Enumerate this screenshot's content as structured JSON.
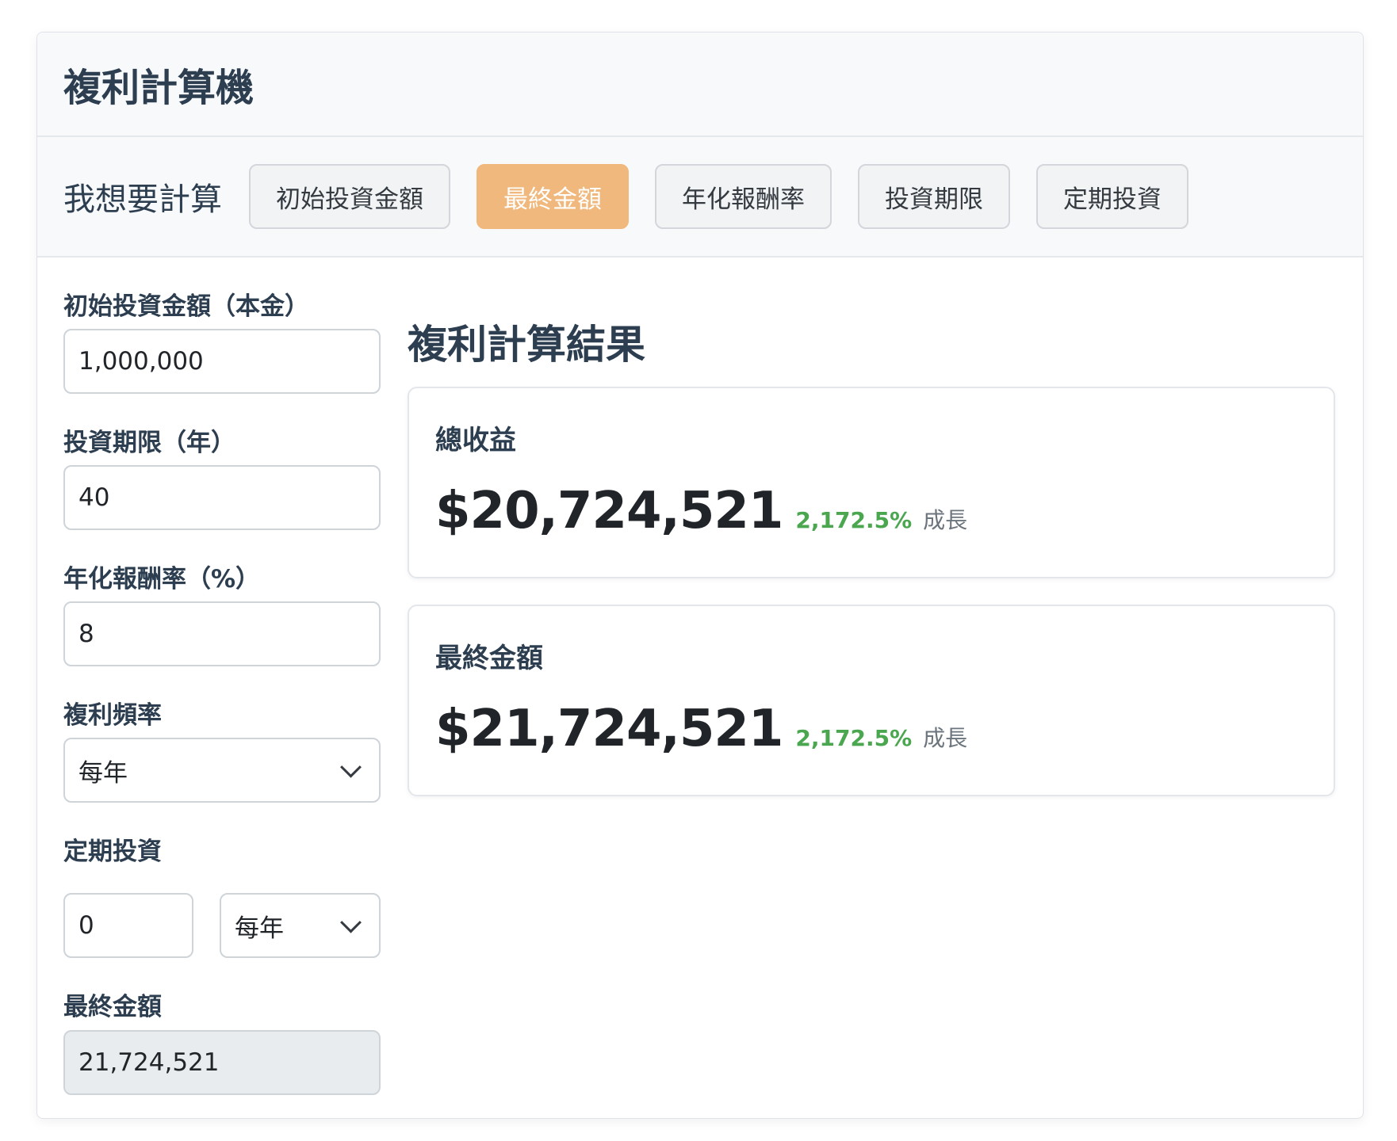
{
  "header": {
    "title": "複利計算機"
  },
  "calc_mode": {
    "label": "我想要計算",
    "options": [
      "初始投資金額",
      "最終金額",
      "年化報酬率",
      "投資期限",
      "定期投資"
    ],
    "active": "最終金額"
  },
  "form": {
    "principal": {
      "label": "初始投資金額（本金）",
      "value": "1,000,000"
    },
    "years": {
      "label": "投資期限（年）",
      "value": "40"
    },
    "rate": {
      "label": "年化報酬率（%）",
      "value": "8"
    },
    "frequency": {
      "label": "複利頻率",
      "value": "每年"
    },
    "periodic": {
      "label": "定期投資",
      "amount": "0",
      "frequency": "每年"
    },
    "final_amount": {
      "label": "最終金額",
      "value": "21,724,521"
    }
  },
  "results": {
    "title": "複利計算結果",
    "cards": [
      {
        "label": "總收益",
        "amount": "$20,724,521",
        "growth": "2,172.5%",
        "suffix": "成長"
      },
      {
        "label": "最終金額",
        "amount": "$21,724,521",
        "growth": "2,172.5%",
        "suffix": "成長"
      }
    ]
  },
  "colors": {
    "active_button": "#f0b87c",
    "growth_green": "#4aa64f",
    "heading": "#2c3e50"
  }
}
